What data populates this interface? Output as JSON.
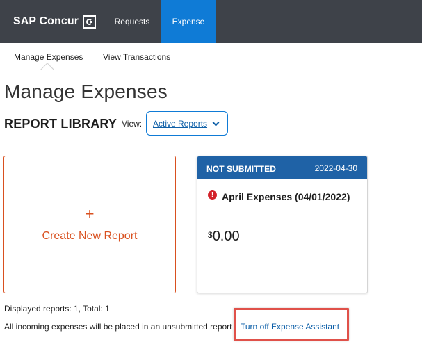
{
  "app": {
    "brand": "SAP Concur",
    "nav": [
      {
        "label": "Requests",
        "active": false
      },
      {
        "label": "Expense",
        "active": true
      }
    ],
    "subnav": [
      {
        "label": "Manage Expenses",
        "active": true
      },
      {
        "label": "View Transactions",
        "active": false
      }
    ]
  },
  "page": {
    "title": "Manage Expenses",
    "library_title": "REPORT LIBRARY",
    "view_label": "View:",
    "view_selected": "Active Reports"
  },
  "create_card": {
    "icon": "+",
    "label": "Create New Report"
  },
  "reports": [
    {
      "status": "NOT SUBMITTED",
      "date": "2022-04-30",
      "name": "April Expenses (04/01/2022)",
      "currency": "$",
      "amount": "0.00",
      "alert_icon": "exclamation-circle-icon"
    }
  ],
  "footer": {
    "displayed": "Displayed reports: 1, Total: 1",
    "incoming": "All incoming expenses will be placed in an unsubmitted report",
    "turn_off_link": "Turn off Expense Assistant"
  },
  "colors": {
    "topbar": "#3e4249",
    "active_tab": "#0f7bd6",
    "create_accent": "#d9501f",
    "report_header": "#1f62a6",
    "link": "#0d5fa8",
    "alert": "#d3222a",
    "highlight_box": "#e0514a"
  }
}
